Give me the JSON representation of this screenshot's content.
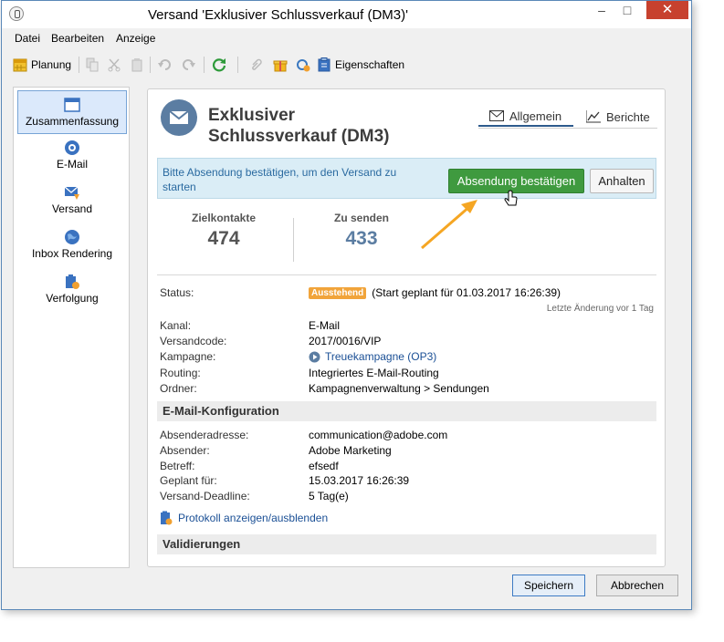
{
  "window": {
    "title": "Versand 'Exklusiver Schlussverkauf (DM3)'"
  },
  "menu": [
    "Datei",
    "Bearbeiten",
    "Anzeige"
  ],
  "toolbar": {
    "planning_label": "Planung",
    "properties_label": "Eigenschaften"
  },
  "sidebar": {
    "items": [
      {
        "label": "Zusammenfassung",
        "icon": "summary-icon",
        "active": true
      },
      {
        "label": "E-Mail",
        "icon": "email-icon"
      },
      {
        "label": "Versand",
        "icon": "delivery-icon"
      },
      {
        "label": "Inbox Rendering",
        "icon": "globe-icon"
      },
      {
        "label": "Verfolgung",
        "icon": "tracking-icon"
      }
    ]
  },
  "header": {
    "title_line1": "Exklusiver",
    "title_line2": "Schlussverkauf (DM3)",
    "tabs": [
      {
        "label": "Allgemein",
        "active": true
      },
      {
        "label": "Berichte"
      }
    ]
  },
  "banner": {
    "message": "Bitte Absendung bestätigen, um den Versand zu starten",
    "confirm_button": "Absendung bestätigen",
    "hold_button": "Anhalten"
  },
  "kpis": [
    {
      "label": "Zielkontakte",
      "value": "474",
      "color": "#555555"
    },
    {
      "label": "Zu senden",
      "value": "433",
      "color": "#5b7da2"
    }
  ],
  "status": {
    "label": "Status:",
    "badge": "Ausstehend",
    "text": "(Start geplant für 01.03.2017 16:26:39)",
    "last_change": "Letzte Änderung vor 1 Tag"
  },
  "properties": [
    {
      "label": "Kanal:",
      "value": "E-Mail"
    },
    {
      "label": "Versandcode:",
      "value": "2017/0016/VIP"
    },
    {
      "label": "Kampagne:",
      "value": "Treuekampagne (OP3)"
    },
    {
      "label": "Routing:",
      "value": "Integriertes E-Mail-Routing"
    },
    {
      "label": "Ordner:",
      "value": "Kampagnenverwaltung > Sendungen"
    }
  ],
  "email_config": {
    "title": "E-Mail-Konfiguration",
    "rows": [
      {
        "label": "Absenderadresse:",
        "value": "communication@adobe.com"
      },
      {
        "label": "Absender:",
        "value": "Adobe Marketing"
      },
      {
        "label": "Betreff:",
        "value": "efsedf"
      },
      {
        "label": "Geplant für:",
        "value": "15.03.2017 16:26:39"
      },
      {
        "label": "Versand-Deadline:",
        "value": "5 Tag(e)"
      }
    ],
    "log_link": "Protokoll anzeigen/ausblenden"
  },
  "validations": {
    "title": "Validierungen"
  },
  "footer": {
    "save_button": "Speichern",
    "cancel_button": "Abbrechen"
  },
  "colors": {
    "accent": "#3f9a3f",
    "link": "#1a4f95",
    "badge": "#f1a43a",
    "arrow": "#f5a623"
  }
}
